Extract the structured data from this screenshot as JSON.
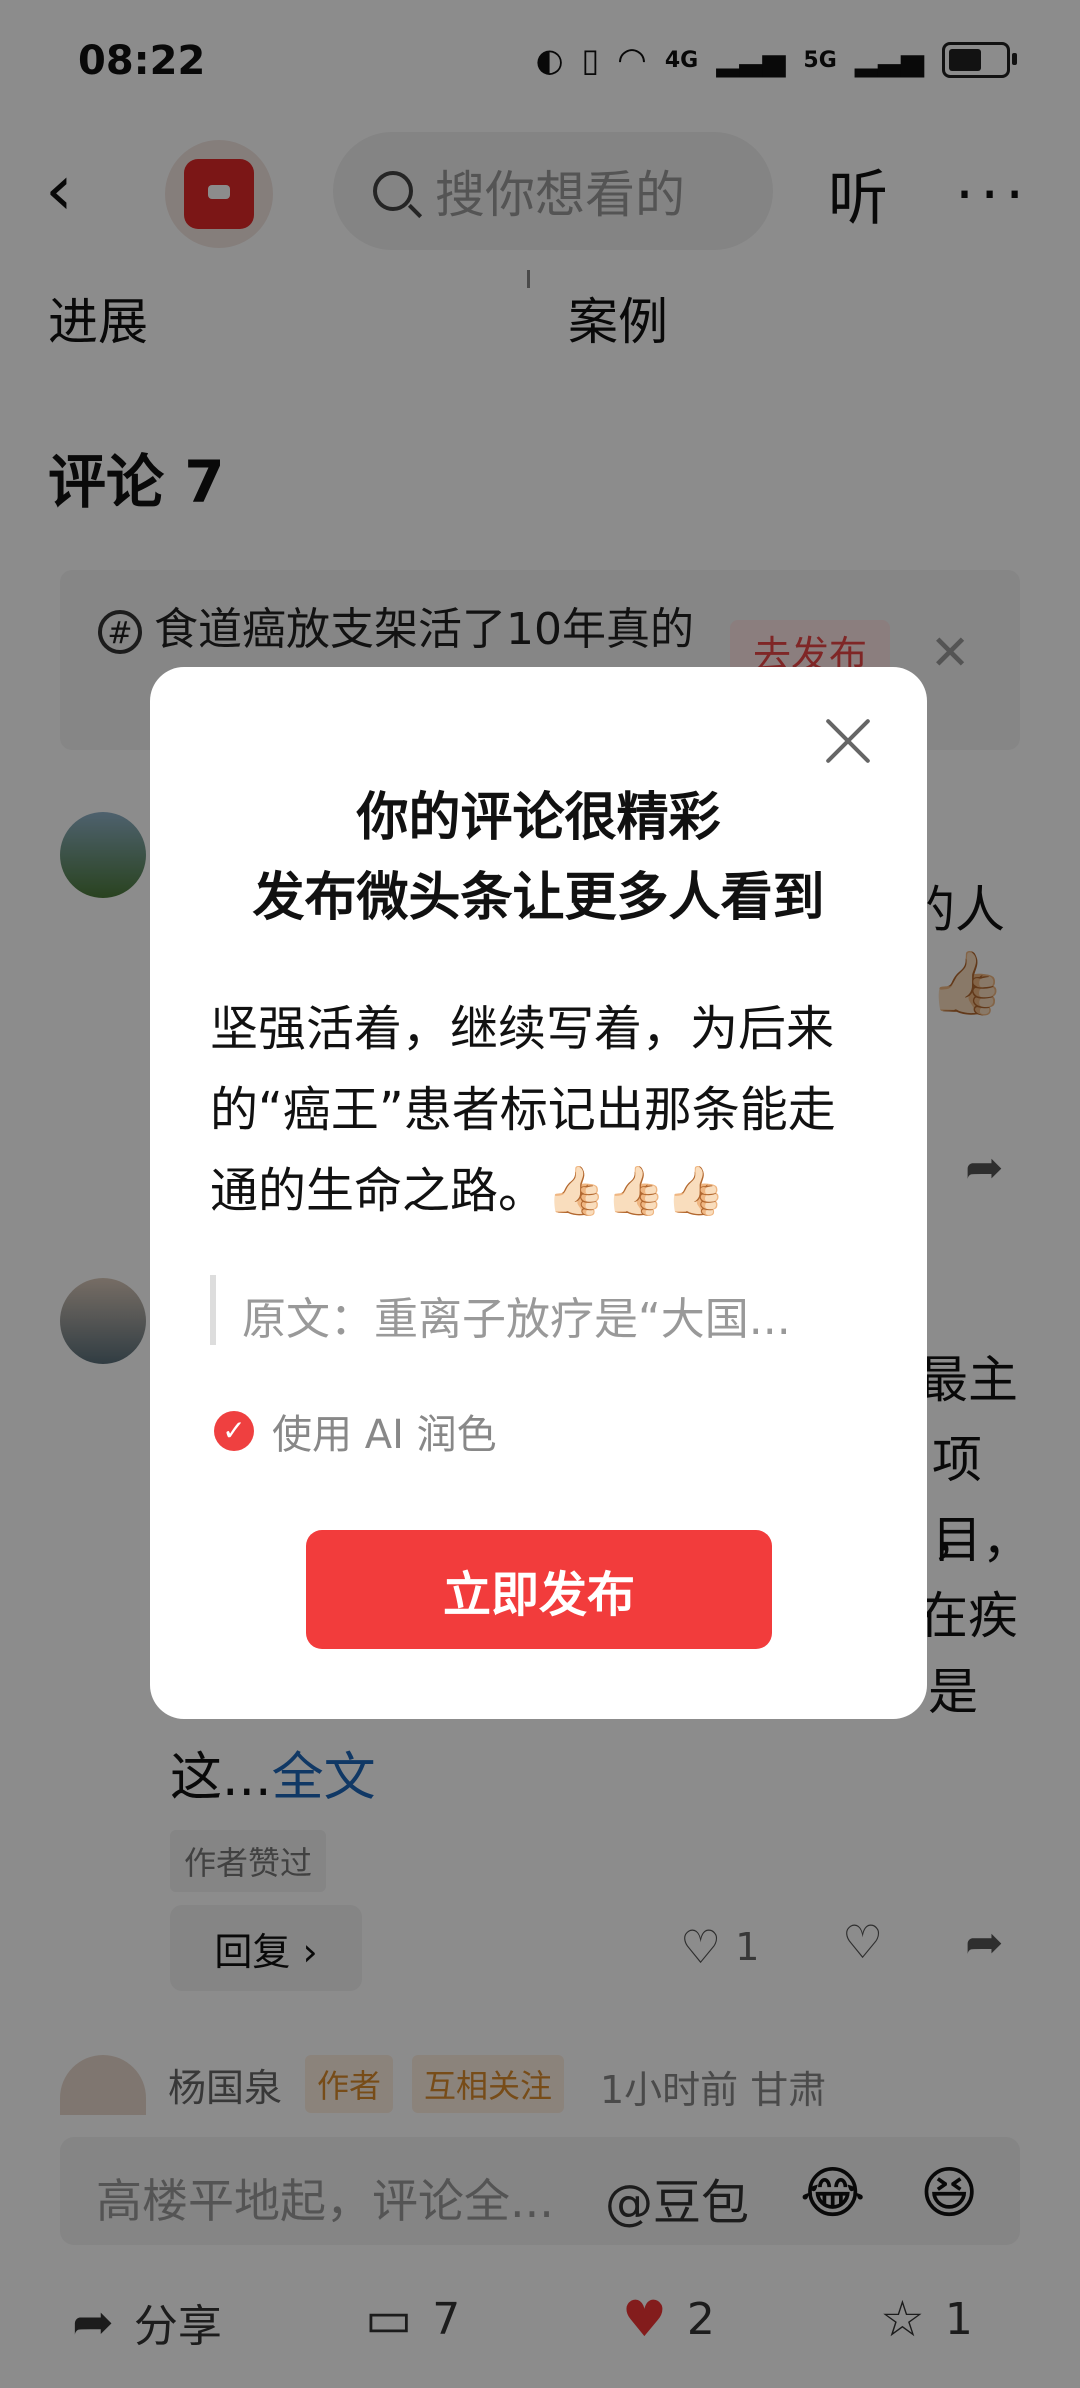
{
  "status_bar": {
    "time": "08:22",
    "net1": "4G",
    "net2": "5G"
  },
  "nav": {
    "search_placeholder": "搜你想看的",
    "listen_label": "听",
    "more_label": "···"
  },
  "tabs": {
    "left": "进展",
    "right": "案例"
  },
  "comments": {
    "title": "评论 7",
    "topic_text": "食道癌放支架活了10年真的",
    "topic_button": "去发布",
    "c1_fragment_1": "的人",
    "c2_fragments": [
      "最主",
      "项目，",
      "，",
      "在疾",
      "是"
    ],
    "full_text_prefix": "这...",
    "full_text_link": "全文",
    "author_liked": "作者赞过",
    "reply_label": "回复 ›",
    "like_count": "1",
    "c3_name": "杨国泉",
    "c3_badge_author": "作者",
    "c3_badge_mutual": "互相关注",
    "c3_meta": "1小时前  甘肃"
  },
  "input_bar": {
    "placeholder": "高楼平地起，评论全...",
    "mention": "@豆包",
    "emoji1": "😂",
    "emoji2": "😆"
  },
  "bottom_bar": {
    "share_label": "分享",
    "comment_count": "7",
    "like_count": "2",
    "fav_count": "1"
  },
  "modal": {
    "title_line1": "你的评论很精彩",
    "title_line2": "发布微头条让更多人看到",
    "content": "坚强活着，继续写着，为后来的“癌王”患者标记出那条能走通的生命之路。👍🏻👍🏻👍🏻",
    "quote": "原文：重离子放疗是“大国...",
    "ai_label": "使用 AI 润色",
    "publish_label": "立即发布",
    "accent": "#f23c3c"
  }
}
